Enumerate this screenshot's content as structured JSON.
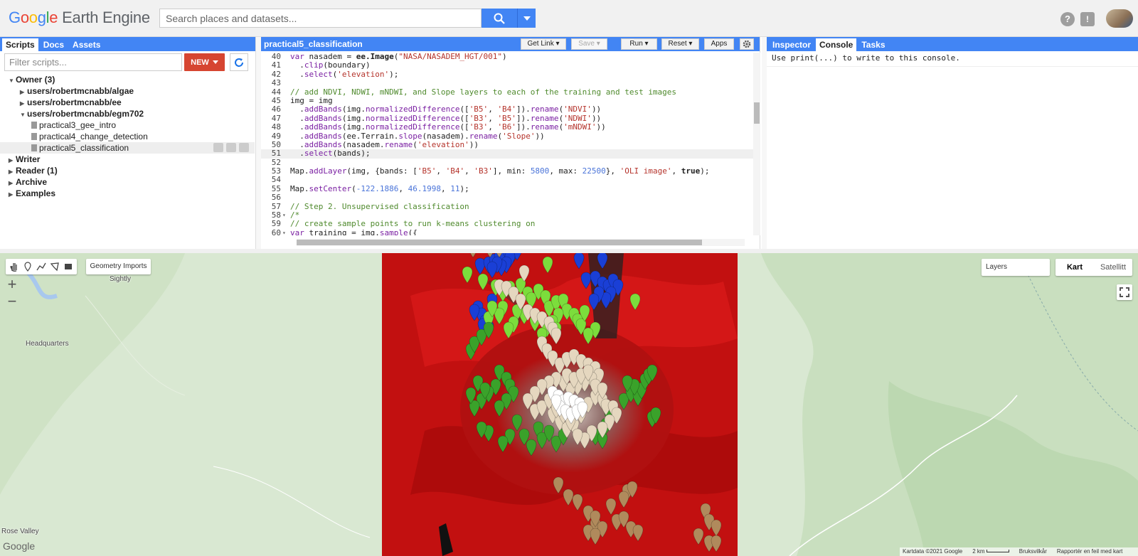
{
  "header": {
    "logo_google": "Google",
    "logo_product": "Earth Engine",
    "search_placeholder": "Search places and datasets..."
  },
  "left_panel": {
    "tabs": [
      "Scripts",
      "Docs",
      "Assets"
    ],
    "active_tab": "Scripts",
    "filter_placeholder": "Filter scripts...",
    "new_label": "NEW",
    "tree": [
      {
        "label": "Owner",
        "count": "(3)",
        "level": 0,
        "expanded": true,
        "bold": true
      },
      {
        "label": "users/robertmcnabb/algae",
        "level": 1,
        "expanded": false,
        "bold": true
      },
      {
        "label": "users/robertmcnabb/ee",
        "level": 1,
        "expanded": false,
        "bold": true
      },
      {
        "label": "users/robertmcnabb/egm702",
        "level": 1,
        "expanded": true,
        "bold": true
      },
      {
        "label": "practical3_gee_intro",
        "level": 2,
        "file": true
      },
      {
        "label": "practical4_change_detection",
        "level": 2,
        "file": true
      },
      {
        "label": "practical5_classification",
        "level": 2,
        "file": true,
        "selected": true
      },
      {
        "label": "Writer",
        "level": 0,
        "expanded": false,
        "bold": true
      },
      {
        "label": "Reader",
        "count": "(1)",
        "level": 0,
        "expanded": false,
        "bold": true
      },
      {
        "label": "Archive",
        "level": 0,
        "expanded": false,
        "bold": true
      },
      {
        "label": "Examples",
        "level": 0,
        "expanded": false,
        "bold": true
      }
    ]
  },
  "editor": {
    "script_name": "practical5_classification",
    "buttons": {
      "get_link": "Get Link",
      "save": "Save",
      "run": "Run",
      "reset": "Reset",
      "apps": "Apps"
    },
    "current_line": 51,
    "lines": [
      {
        "n": 40,
        "fold": false,
        "html": "<span class=\"kw\">var</span> nasadem = <span class=\"bold\">ee.Image</span>(<span class=\"str\">\"NASA/NASADEM_HGT/001\"</span>)"
      },
      {
        "n": 41,
        "fold": false,
        "html": "  .<span class=\"kw\">clip</span>(boundary)"
      },
      {
        "n": 42,
        "fold": false,
        "html": "  .<span class=\"kw\">select</span>(<span class=\"str\">'elevation'</span>);"
      },
      {
        "n": 43,
        "fold": false,
        "html": ""
      },
      {
        "n": 44,
        "fold": false,
        "html": "<span class=\"cm\">// add NDVI, NDWI, mNDWI, and Slope layers to each of the training and test images</span>"
      },
      {
        "n": 45,
        "fold": false,
        "html": "img = img"
      },
      {
        "n": 46,
        "fold": false,
        "html": "  .<span class=\"kw\">addBands</span>(img.<span class=\"kw\">normalizedDifference</span>([<span class=\"str\">'B5'</span>, <span class=\"str\">'B4'</span>]).<span class=\"kw\">rename</span>(<span class=\"str\">'NDVI'</span>))"
      },
      {
        "n": 47,
        "fold": false,
        "html": "  .<span class=\"kw\">addBands</span>(img.<span class=\"kw\">normalizedDifference</span>([<span class=\"str\">'B3'</span>, <span class=\"str\">'B5'</span>]).<span class=\"kw\">rename</span>(<span class=\"str\">'NDWI'</span>))"
      },
      {
        "n": 48,
        "fold": false,
        "html": "  .<span class=\"kw\">addBands</span>(img.<span class=\"kw\">normalizedDifference</span>([<span class=\"str\">'B3'</span>, <span class=\"str\">'B6'</span>]).<span class=\"kw\">rename</span>(<span class=\"str\">'mNDWI'</span>))"
      },
      {
        "n": 49,
        "fold": false,
        "html": "  .<span class=\"kw\">addBands</span>(ee.Terrain.<span class=\"kw\">slope</span>(nasadem).<span class=\"kw\">rename</span>(<span class=\"str\">'Slope'</span>))"
      },
      {
        "n": 50,
        "fold": false,
        "html": "  .<span class=\"kw\">addBands</span>(nasadem.<span class=\"kw\">rename</span>(<span class=\"str\">'elevation'</span>))"
      },
      {
        "n": 51,
        "fold": false,
        "html": "  .<span class=\"kw\">select</span>(bands);"
      },
      {
        "n": 52,
        "fold": false,
        "html": ""
      },
      {
        "n": 53,
        "fold": false,
        "html": "Map.<span class=\"kw\">addLayer</span>(img, {bands: [<span class=\"str\">'B5'</span>, <span class=\"str\">'B4'</span>, <span class=\"str\">'B3'</span>], min: <span class=\"num\">5800</span>, max: <span class=\"num\">22500</span>}, <span class=\"str\">'OLI image'</span>, <span class=\"bold\">true</span>);"
      },
      {
        "n": 54,
        "fold": false,
        "html": ""
      },
      {
        "n": 55,
        "fold": false,
        "html": "Map.<span class=\"kw\">setCenter</span>(<span class=\"num\">-122.1886</span>, <span class=\"num\">46.1998</span>, <span class=\"num\">11</span>);"
      },
      {
        "n": 56,
        "fold": false,
        "html": ""
      },
      {
        "n": 57,
        "fold": false,
        "html": "<span class=\"cm\">// Step 2. Unsupervised classification</span>"
      },
      {
        "n": 58,
        "fold": true,
        "html": "<span class=\"cm\">/*</span>"
      },
      {
        "n": 59,
        "fold": false,
        "html": "<span class=\"cm\">// create sample points to run k-means clustering on</span>"
      },
      {
        "n": 60,
        "fold": true,
        "html": "<span class=\"kw\">var</span> training = img.<span class=\"kw\">sample</span>({"
      }
    ]
  },
  "console": {
    "tabs": [
      "Inspector",
      "Console",
      "Tasks"
    ],
    "active_tab": "Console",
    "text": "Use print(...) to write to this console."
  },
  "map": {
    "geometry_imports": "Geometry Imports",
    "layers_label": "Layers",
    "map_types": [
      "Kart",
      "Satellitt"
    ],
    "active_map_type": "Kart",
    "places": [
      "Sightly",
      "Headquarters",
      "Rose Valley"
    ],
    "footer": {
      "attribution": "Kartdata ©2021 Google",
      "scale": "2 km",
      "terms": "Bruksvilkår",
      "report": "Rapportér en feil med kart"
    },
    "watermark": "Google",
    "pin_colors": {
      "water": "#1a3fd6",
      "vegetation": "#7cdd3c",
      "dark_vegetation": "#3aa22a",
      "snow": "#e5d7bf",
      "ice": "#ffffff",
      "bare": "#b08a5c"
    }
  }
}
